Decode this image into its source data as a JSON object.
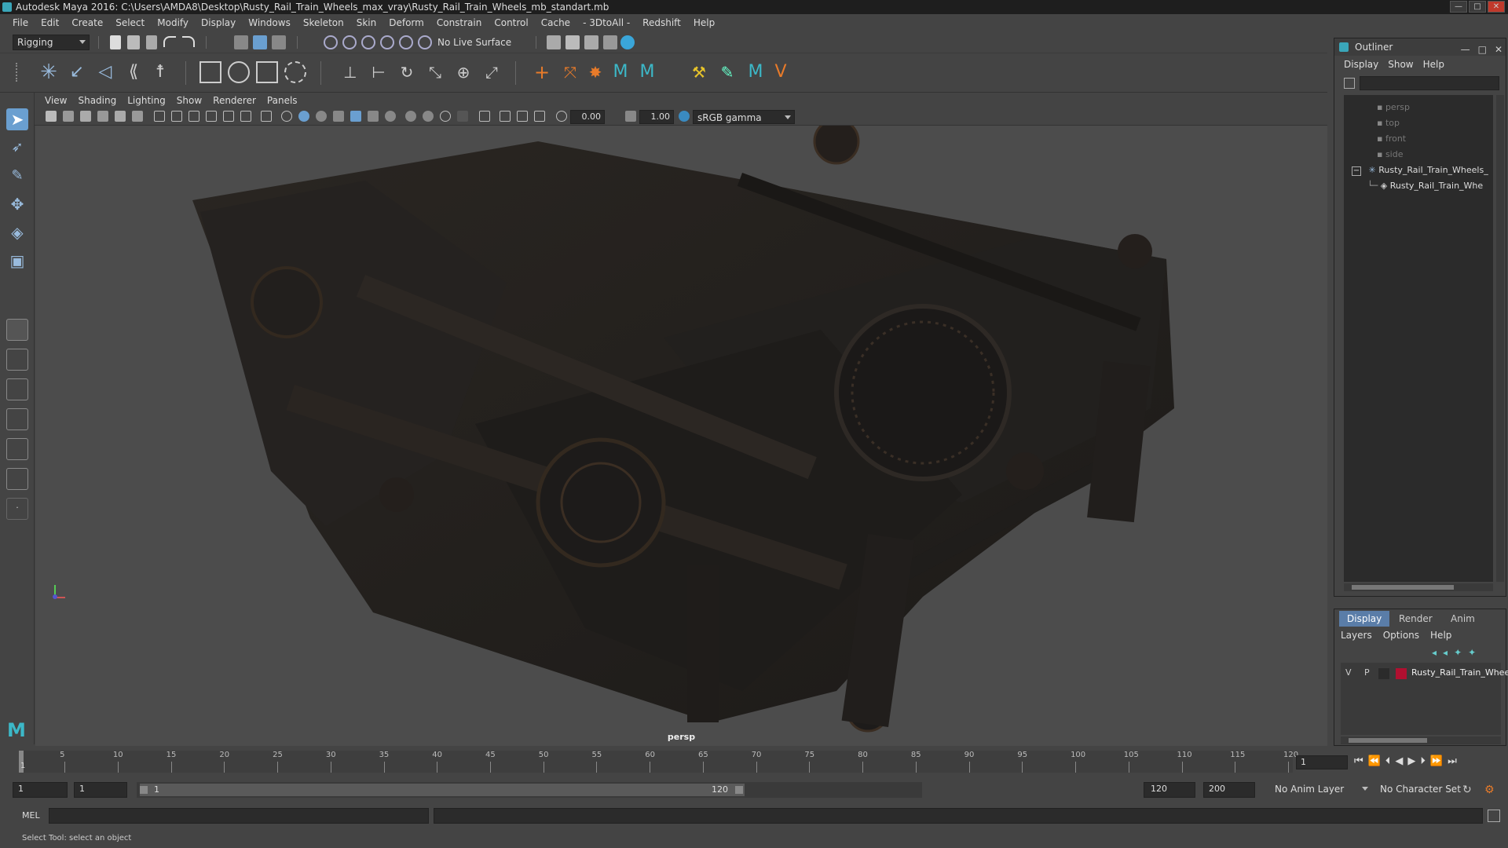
{
  "window": {
    "title": "Autodesk Maya 2016: C:\\Users\\AMDA8\\Desktop\\Rusty_Rail_Train_Wheels_max_vray\\Rusty_Rail_Train_Wheels_mb_standart.mb",
    "buttons": [
      "—",
      "□",
      "✕"
    ]
  },
  "menubar": [
    "File",
    "Edit",
    "Create",
    "Select",
    "Modify",
    "Display",
    "Windows",
    "Skeleton",
    "Skin",
    "Deform",
    "Constrain",
    "Control",
    "Cache",
    "- 3DtoAll -",
    "Redshift",
    "Help"
  ],
  "statusline": {
    "menuset": "Rigging",
    "live_surface": "No Live Surface"
  },
  "panel": {
    "menus": [
      "View",
      "Shading",
      "Lighting",
      "Show",
      "Renderer",
      "Panels"
    ],
    "exposure": "0.00",
    "gamma": "1.00",
    "color_space": "sRGB gamma",
    "camera_label": "persp"
  },
  "outliner": {
    "title": "Outliner",
    "menus": [
      "Display",
      "Show",
      "Help"
    ],
    "items": [
      {
        "label": "persp",
        "dim": true
      },
      {
        "label": "top",
        "dim": true
      },
      {
        "label": "front",
        "dim": true
      },
      {
        "label": "side",
        "dim": true
      },
      {
        "label": "Rusty_Rail_Train_Wheels_",
        "dim": false
      },
      {
        "label": "Rusty_Rail_Train_Whe",
        "dim": false
      }
    ]
  },
  "layer_editor": {
    "tabs": [
      "Display",
      "Render",
      "Anim"
    ],
    "menus": [
      "Layers",
      "Options",
      "Help"
    ],
    "layer": {
      "v": "V",
      "p": "P",
      "name": "Rusty_Rail_Train_Whee",
      "color": "#b01030"
    }
  },
  "timeline": {
    "ticks": [
      "5",
      "10",
      "15",
      "20",
      "25",
      "30",
      "35",
      "40",
      "45",
      "50",
      "55",
      "60",
      "65",
      "70",
      "75",
      "80",
      "85",
      "90",
      "95",
      "100",
      "105",
      "110",
      "115",
      "120"
    ],
    "start_tick": "1",
    "current_frame": "1"
  },
  "range": {
    "start": "1",
    "inner_start": "1",
    "slider_start": "1",
    "slider_end": "120",
    "inner_end": "120",
    "end": "200",
    "anim_layer": "No Anim Layer",
    "char_set": "No Character Set"
  },
  "cmdline": {
    "label": "MEL"
  },
  "helpline": {
    "text": "Select Tool: select an object"
  }
}
